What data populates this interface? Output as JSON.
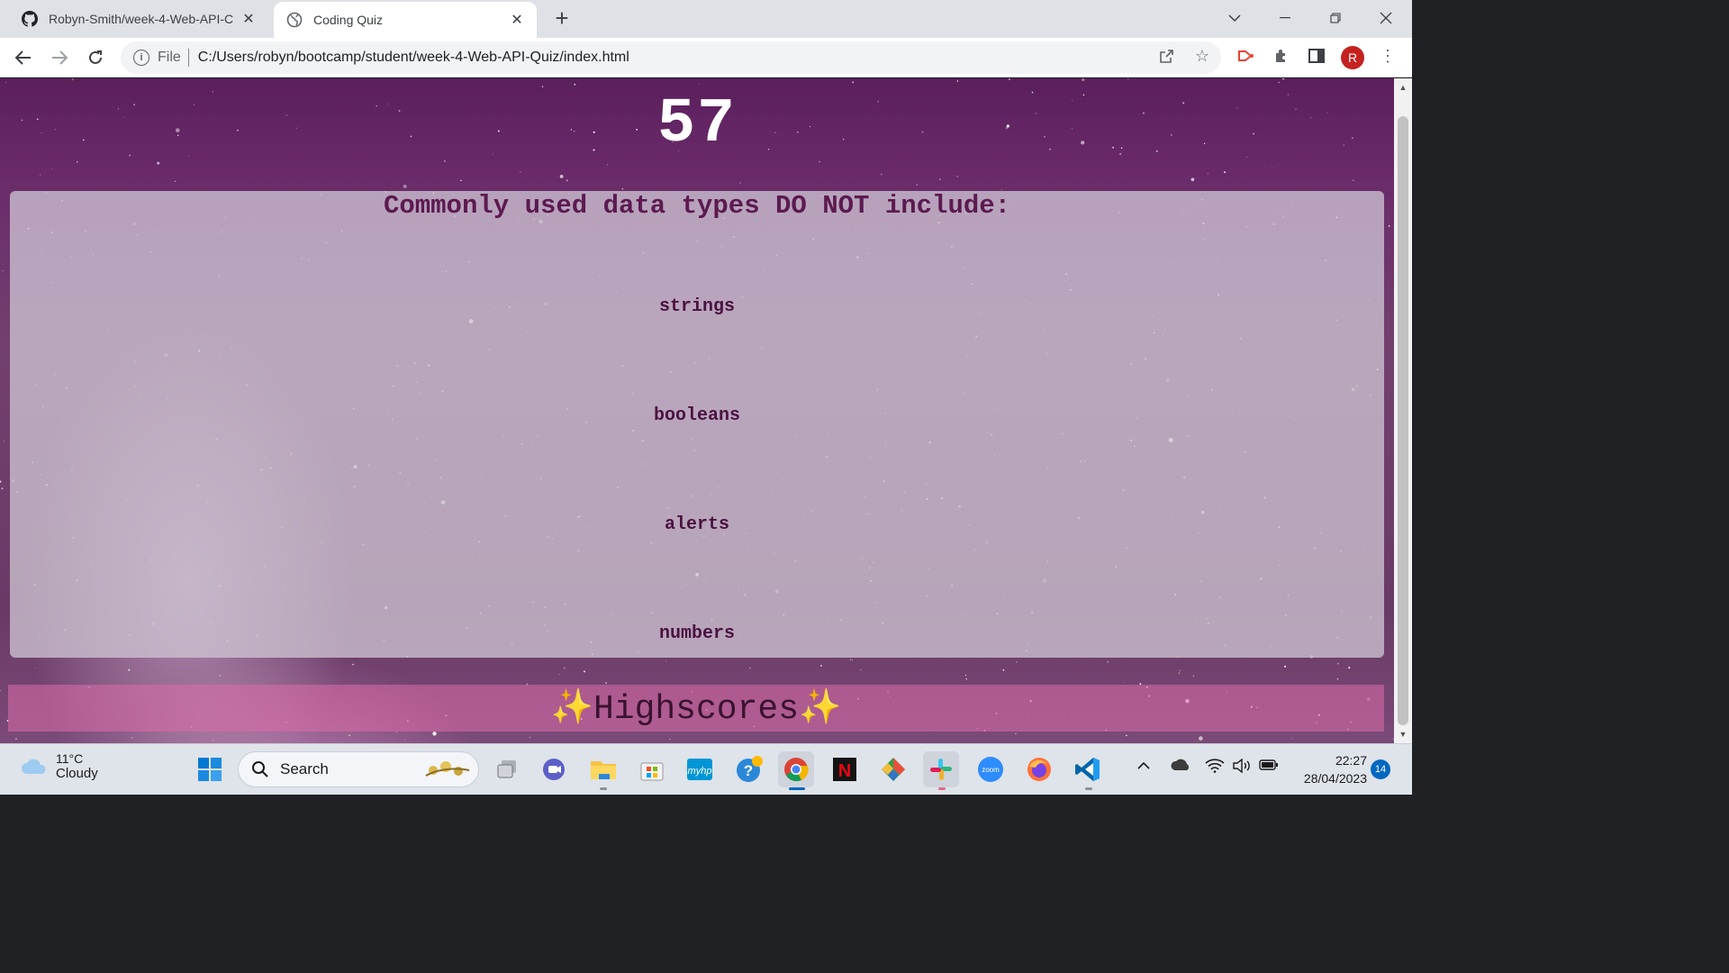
{
  "browser": {
    "tabs": [
      {
        "title": "Robyn-Smith/week-4-Web-API-C",
        "icon": "github-icon",
        "active": false
      },
      {
        "title": "Coding Quiz",
        "icon": "globe-icon",
        "active": true
      }
    ],
    "address": {
      "scheme": "File",
      "url": "C:/Users/robyn/bootcamp/student/week-4-Web-API-Quiz/index.html"
    },
    "profile_initial": "R"
  },
  "page": {
    "timer": "57",
    "question": "Commonly used data types DO NOT include:",
    "answers": [
      "strings",
      "booleans",
      "alerts",
      "numbers"
    ],
    "highscores_label": "✨Highscores✨"
  },
  "taskbar": {
    "weather": {
      "temp": "11°C",
      "condition": "Cloudy"
    },
    "search_placeholder": "Search",
    "clock": {
      "time": "22:27",
      "date": "28/04/2023"
    },
    "notification_count": "14"
  },
  "colors": {
    "accent_purple": "#5c1a50",
    "highscores_pink": "#dc6eaa",
    "profile_red": "#c5221f"
  }
}
